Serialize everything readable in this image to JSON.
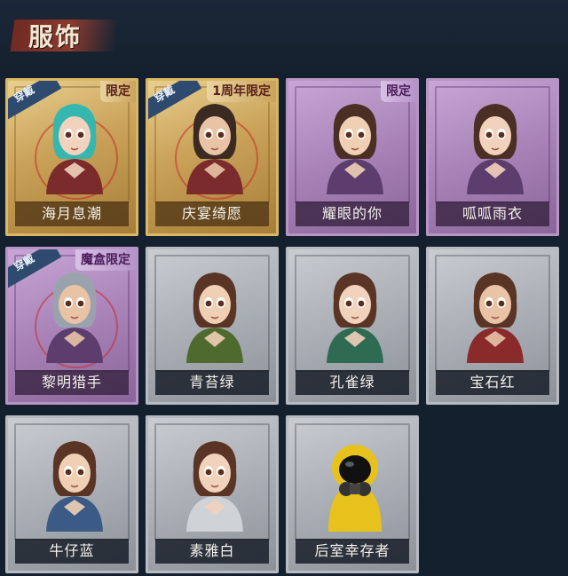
{
  "header": {
    "title": "服饰"
  },
  "items": [
    {
      "name": "海月息潮",
      "tier": "gold",
      "wear": "穿戴",
      "limit": "限定"
    },
    {
      "name": "庆宴绮愿",
      "tier": "gold",
      "wear": "穿戴",
      "limit": "1周年限定"
    },
    {
      "name": "耀眼的你",
      "tier": "purple",
      "wear": "",
      "limit": "限定"
    },
    {
      "name": "呱呱雨衣",
      "tier": "purple",
      "wear": "",
      "limit": ""
    },
    {
      "name": "黎明猎手",
      "tier": "purple",
      "wear": "穿戴",
      "limit": "魔盒限定"
    },
    {
      "name": "青苔绿",
      "tier": "grey",
      "wear": "",
      "limit": ""
    },
    {
      "name": "孔雀绿",
      "tier": "grey",
      "wear": "",
      "limit": ""
    },
    {
      "name": "宝石红",
      "tier": "grey",
      "wear": "",
      "limit": ""
    },
    {
      "name": "牛仔蓝",
      "tier": "grey",
      "wear": "",
      "limit": ""
    },
    {
      "name": "素雅白",
      "tier": "grey",
      "wear": "",
      "limit": ""
    },
    {
      "name": "后室幸存者",
      "tier": "grey",
      "wear": "",
      "limit": ""
    }
  ],
  "colors": {
    "background": "#15202f",
    "gold": "#d9b566",
    "purple": "#b794c6",
    "grey": "#b7bbc1"
  }
}
